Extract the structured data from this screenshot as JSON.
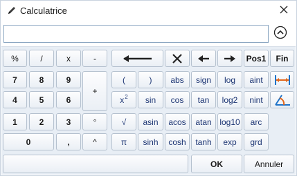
{
  "window": {
    "title": "Calculatrice"
  },
  "expression": {
    "value": ""
  },
  "keypad": {
    "percent": "%",
    "divide": "/",
    "multiply": "x",
    "minus": "-",
    "plus": "+",
    "n7": "7",
    "n8": "8",
    "n9": "9",
    "n4": "4",
    "n5": "5",
    "n6": "6",
    "n1": "1",
    "n2": "2",
    "n3": "3",
    "n0": "0",
    "comma": ",",
    "power": "^",
    "degree": "°"
  },
  "nav": {
    "home": "Pos1",
    "end": "Fin"
  },
  "functions": {
    "paren_open": "(",
    "paren_close": ")",
    "abs": "abs",
    "sign": "sign",
    "log": "log",
    "aint": "aint",
    "square": "x",
    "square_sup": "2",
    "sin": "sin",
    "cos": "cos",
    "tan": "tan",
    "log2": "log2",
    "nint": "nint",
    "sqrt": "√",
    "asin": "asin",
    "acos": "acos",
    "atan": "atan",
    "log10": "log10",
    "arc": "arc",
    "pi": "π",
    "sinh": "sinh",
    "cosh": "cosh",
    "tanh": "tanh",
    "exp": "exp",
    "grd": "grd"
  },
  "dialog": {
    "ok": "OK",
    "cancel": "Annuler"
  },
  "colors": {
    "accent_blue": "#1f74c9",
    "accent_orange": "#e2661b",
    "function_text": "#1c3573",
    "panel_bg": "#e8eef5"
  }
}
